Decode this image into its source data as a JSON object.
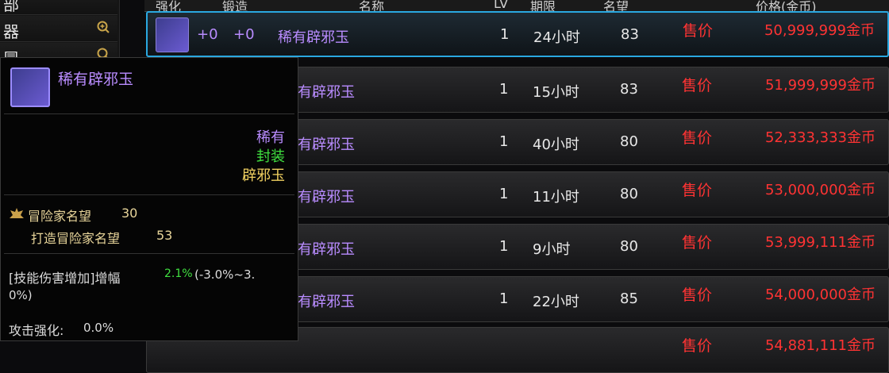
{
  "sidebar": {
    "items": [
      {
        "label": "部"
      },
      {
        "label": "器"
      },
      {
        "label": "冒"
      }
    ]
  },
  "table": {
    "headers": [
      "强化",
      "锻造",
      "名称",
      "LV",
      "期限",
      "名望",
      "价格(金币)"
    ],
    "rows": [
      {
        "strength": "+0",
        "forge": "+0",
        "name": "稀有辟邪玉",
        "lv": "1",
        "period": "24小时",
        "fame": "83",
        "sale": "售价",
        "price": "50,999,999金币",
        "selected": true
      },
      {
        "name": "有辟邪玉",
        "lv": "1",
        "period": "15小时",
        "fame": "83",
        "sale": "售价",
        "price": "51,999,999金币"
      },
      {
        "name": "有辟邪玉",
        "lv": "1",
        "period": "40小时",
        "fame": "80",
        "sale": "售价",
        "price": "52,333,333金币"
      },
      {
        "name": "有辟邪玉",
        "lv": "1",
        "period": "11小时",
        "fame": "80",
        "sale": "售价",
        "price": "53,000,000金币"
      },
      {
        "name": "有辟邪玉",
        "lv": "1",
        "period": "9小时",
        "fame": "80",
        "sale": "售价",
        "price": "53,999,111金币"
      },
      {
        "name": "有辟邪玉",
        "lv": "1",
        "period": "22小时",
        "fame": "85",
        "sale": "售价",
        "price": "54,000,000金币"
      },
      {
        "name": "",
        "lv": "",
        "period": "",
        "fame": "",
        "sale": "售价",
        "price": "54,881,111金币"
      }
    ]
  },
  "tooltip": {
    "title": "稀有辟邪玉",
    "rarity": "稀有",
    "seal": "封装",
    "type": "辟邪玉",
    "fame_label": "冒险家名望",
    "fame_value": "30",
    "fame2_label": "打造冒险家名望",
    "fame2_value": "53",
    "skill_label": "[技能伤害增加]增幅",
    "skill_value": "2.1%",
    "skill_range": "(-3.0%~3.",
    "skill_range2": "0%)",
    "atk_label": "攻击强化:",
    "atk_value": "0.0%"
  },
  "colors": {
    "rare_purple": "#b98cff",
    "price_red": "#ff3333",
    "seal_green": "#40e040",
    "select_blue": "#2aa8e0"
  }
}
